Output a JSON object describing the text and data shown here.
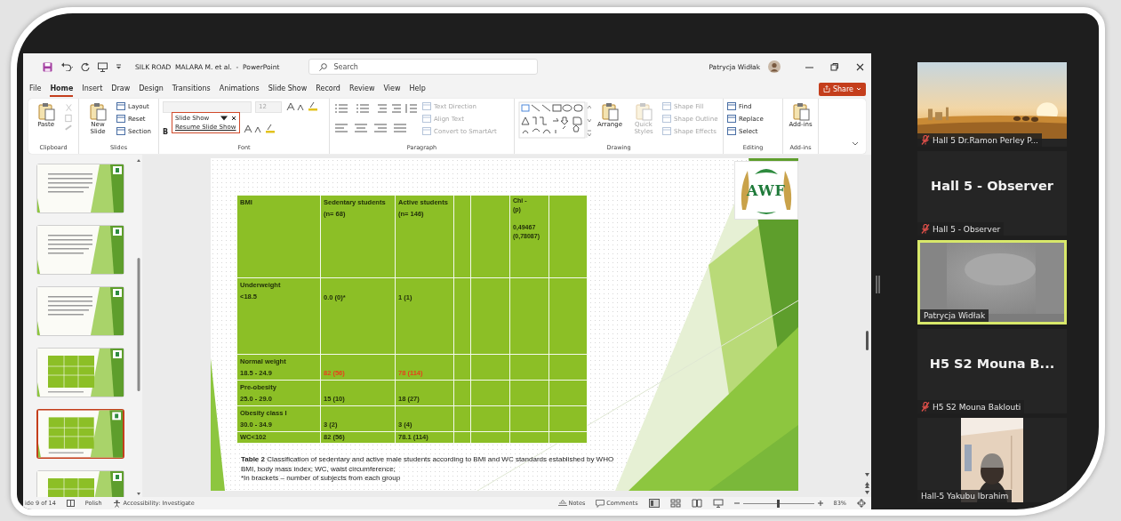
{
  "powerpoint": {
    "title": "SILK ROAD  MALARA M. et al.  -  PowerPoint",
    "search": {
      "placeholder": "Search"
    },
    "user": "Patrycja Widłak",
    "share_button": "Share",
    "tabs": [
      {
        "label": "File",
        "selected": false
      },
      {
        "label": "Home",
        "selected": true
      },
      {
        "label": "Insert",
        "selected": false
      },
      {
        "label": "Draw",
        "selected": false
      },
      {
        "label": "Design",
        "selected": false
      },
      {
        "label": "Transitions",
        "selected": false
      },
      {
        "label": "Animations",
        "selected": false
      },
      {
        "label": "Slide Show",
        "selected": false
      },
      {
        "label": "Record",
        "selected": false
      },
      {
        "label": "Review",
        "selected": false
      },
      {
        "label": "View",
        "selected": false
      },
      {
        "label": "Help",
        "selected": false
      }
    ],
    "ribbon": [
      {
        "label": "Clipboard",
        "items": [
          {
            "kind": "large",
            "label": "Paste",
            "disabled": false
          },
          {
            "kind": "icon-row",
            "disabled": true
          }
        ]
      },
      {
        "label": "Slides",
        "items": [
          {
            "kind": "large",
            "label": "New Slide",
            "disabled": false
          },
          {
            "kind": "small",
            "label": "Layout",
            "disabled": false
          },
          {
            "kind": "small",
            "label": "Reset",
            "disabled": false
          },
          {
            "kind": "small",
            "label": "Section",
            "disabled": false
          }
        ]
      },
      {
        "label": "Font",
        "items": [
          {
            "kind": "field",
            "disabled": true
          },
          {
            "kind": "field",
            "label": "12",
            "disabled": true
          },
          {
            "kind": "icon-row",
            "disabled": false
          },
          {
            "kind": "glyph",
            "label": "B",
            "disabled": false
          },
          {
            "kind": "icon-row",
            "disabled": false
          }
        ]
      },
      {
        "label": "Paragraph",
        "items": [
          {
            "kind": "paragraph-tools",
            "disabled": false
          },
          {
            "kind": "small",
            "label": "Text Direction",
            "disabled": true
          },
          {
            "kind": "small",
            "label": "Align Text",
            "disabled": true
          },
          {
            "kind": "small",
            "label": "Convert to SmartArt",
            "disabled": true
          }
        ]
      },
      {
        "label": "Drawing",
        "items": [
          {
            "kind": "gallery",
            "disabled": false
          },
          {
            "kind": "large",
            "label": "Arrange",
            "disabled": false
          },
          {
            "kind": "large",
            "label": "Quick Styles",
            "disabled": true
          },
          {
            "kind": "small",
            "label": "Shape Fill",
            "disabled": true
          },
          {
            "kind": "small",
            "label": "Shape Outline",
            "disabled": true
          },
          {
            "kind": "small",
            "label": "Shape Effects",
            "disabled": true
          }
        ]
      },
      {
        "label": "Editing",
        "items": [
          {
            "kind": "small",
            "label": "Find",
            "disabled": false
          },
          {
            "kind": "small",
            "label": "Replace",
            "disabled": false
          },
          {
            "kind": "small",
            "label": "Select",
            "disabled": false
          }
        ]
      },
      {
        "label": "Add-ins",
        "items": [
          {
            "kind": "large",
            "label": "Add-ins",
            "disabled": false
          }
        ]
      }
    ],
    "floating_toolbar": {
      "title": "Slide Show",
      "action": "Resume Slide Show"
    },
    "thumbnails": [
      {
        "kind": "text",
        "selected": false
      },
      {
        "kind": "text",
        "selected": false
      },
      {
        "kind": "text",
        "selected": false
      },
      {
        "kind": "table",
        "selected": false
      },
      {
        "kind": "table",
        "selected": true
      },
      {
        "kind": "table",
        "selected": false
      }
    ],
    "slide": {
      "logo": "AWF",
      "table": {
        "header": {
          "bmi": "BMI",
          "sedentary": [
            "Sedentary students",
            "(n= 68)"
          ],
          "active": [
            "Active students",
            "(n= 146)"
          ],
          "chi": {
            "label": [
              "Chi -",
              "(p)"
            ],
            "value": [
              "0,49467",
              "(0,78087)"
            ]
          }
        },
        "rows": [
          {
            "label": [
              "Underweight",
              "<18.5"
            ],
            "sedentary": {
              "text": "0.0 (0)*"
            },
            "active": {
              "text": "1 (1)"
            }
          },
          {
            "label": [
              "Normal weight",
              "18.5 - 24.9"
            ],
            "sedentary": {
              "text": "82 (56)",
              "color": "#e8401c"
            },
            "active": {
              "text": "78 (114)",
              "color": "#e8401c"
            }
          },
          {
            "label": [
              "Pre-obesity",
              "25.0 - 29.0"
            ],
            "sedentary": {
              "text": "15 (10)"
            },
            "active": {
              "text": "18 (27)"
            }
          },
          {
            "label": [
              "Obesity class I",
              "30.0 - 34.9"
            ],
            "sedentary": {
              "text": "3 (2)"
            },
            "active": {
              "text": "3 (4)"
            }
          },
          {
            "label": [
              "WC<102"
            ],
            "sedentary": {
              "text": "82 (56)"
            },
            "active": {
              "text": "78.1 (114)"
            }
          }
        ]
      },
      "caption": [
        "**Table 2**  Classification of sedentary and active male students according to BMI and WC standards  established by WHO",
        "BMI, body mass index; WC, waist circumference;",
        "*In brackets – number of subjects from each group"
      ]
    },
    "status_bar": {
      "slide": "ide 9 of 14",
      "language": "Polish",
      "accessibility": "Accessibility: Investigate",
      "notes": "Notes",
      "comments": "Comments",
      "zoom": "83%",
      "zoom_slider": {
        "level": 0.5
      }
    }
  },
  "meeting": {
    "participants": [
      {
        "kind": "video",
        "name": "Hall 5 Dr.Ramon Perley P...",
        "muted": true,
        "active": false
      },
      {
        "kind": "name",
        "display_name": "Hall 5 - Observer",
        "name": "Hall 5 - Observer",
        "muted": true,
        "active": false
      },
      {
        "kind": "video",
        "name": "Patrycja Widłak",
        "muted": false,
        "active": true
      },
      {
        "kind": "name",
        "display_name": "H5 S2 Mouna B...",
        "name": "H5 S2 Mouna Baklouti",
        "muted": true,
        "active": false
      },
      {
        "kind": "portrait",
        "name": "Hall-5  Yakubu Ibrahim",
        "muted": false,
        "active": false
      }
    ]
  }
}
